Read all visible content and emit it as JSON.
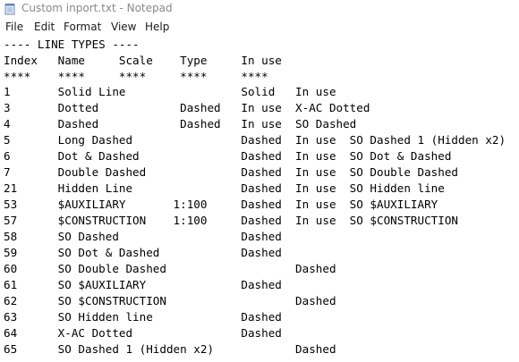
{
  "window": {
    "title": "Custom inport.txt - Notepad",
    "icon": "notepad-icon"
  },
  "menu": [
    "File",
    "Edit",
    "Format",
    "View",
    "Help"
  ],
  "document": {
    "lines": [
      "---- LINE TYPES ----",
      "Index   Name     Scale    Type     In use",
      "****    ****     ****     ****     ****",
      "",
      "1       Solid Line                 Solid   In use",
      "3       Dotted            Dashed   In use  X-AC Dotted",
      "4       Dashed            Dashed   In use  SO Dashed",
      "5       Long Dashed                Dashed  In use  SO Dashed 1 (Hidden x2)",
      "6       Dot & Dashed               Dashed  In use  SO Dot & Dashed",
      "7       Double Dashed              Dashed  In use  SO Double Dashed",
      "21      Hidden Line                Dashed  In use  SO Hidden line",
      "53      $AUXILIARY       1:100     Dashed  In use  SO $AUXILIARY",
      "57      $CONSTRUCTION    1:100     Dashed  In use  SO $CONSTRUCTION",
      "58      SO Dashed                  Dashed",
      "59      SO Dot & Dashed            Dashed",
      "60      SO Double Dashed                   Dashed",
      "61      SO $AUXILIARY              Dashed",
      "62      SO $CONSTRUCTION                   Dashed",
      "63      SO Hidden line             Dashed",
      "64      X-AC Dotted                Dashed",
      "65      SO Dashed 1 (Hidden x2)            Dashed"
    ]
  }
}
